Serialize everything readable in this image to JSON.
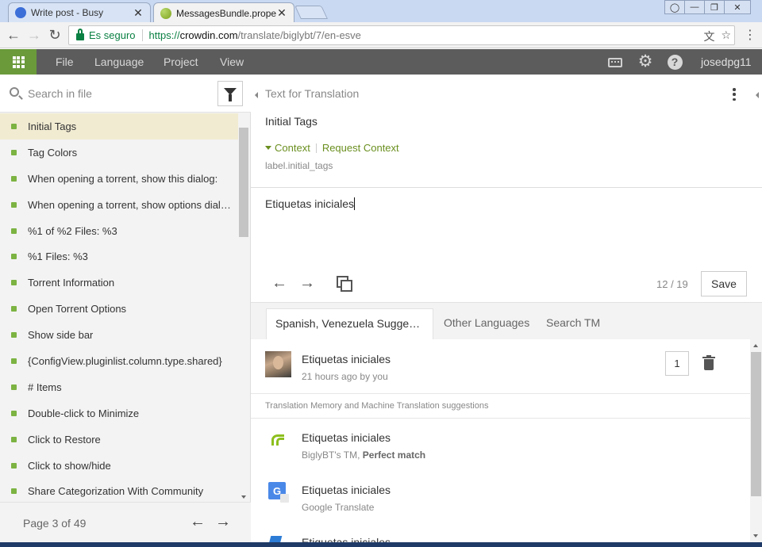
{
  "browser": {
    "tabs": [
      {
        "label": "Write post - Busy",
        "active": false,
        "icon": "busy-icon"
      },
      {
        "label": "MessagesBundle.properti",
        "active": true,
        "icon": "crowdin-icon"
      }
    ],
    "tab_close": "✕",
    "secure_label": "Es seguro",
    "url_proto": "https://",
    "url_host": "crowdin.com",
    "url_path": "/translate/biglybt/7/en-esve",
    "colors": {
      "secure": "#0b8043",
      "tabbar": "#c9d9f2"
    }
  },
  "app": {
    "menu": [
      "File",
      "Language",
      "Project",
      "View"
    ],
    "username": "josedpg11",
    "accent": "#6a9a3a",
    "appbar_bg": "#5c5c5c",
    "icons": [
      "keyboard-icon",
      "gear-icon",
      "help-icon"
    ]
  },
  "left": {
    "search_placeholder": "Search in file",
    "strings": [
      "Initial Tags",
      "Tag Colors",
      "When opening a torrent, show this dialog:",
      "When opening a torrent, show options dialog",
      "%1 of %2 Files: %3",
      "%1 Files: %3",
      "Torrent Information",
      "Open Torrent Options",
      "Show side bar",
      "{ConfigView.pluginlist.column.type.shared}",
      "# Items",
      "Double-click to Minimize",
      "Click to Restore",
      "Click to show/hide",
      "Share Categorization With Community"
    ],
    "selected_index": 0,
    "page_label": "Page 3 of 49"
  },
  "editor": {
    "heading": "Text for Translation",
    "source_text": "Initial Tags",
    "context_label": "Context",
    "request_context_label": "Request Context",
    "context_key": "label.initial_tags",
    "translation": "Etiquetas iniciales",
    "counter": "12 / 19",
    "save_label": "Save"
  },
  "tm": {
    "tabs": [
      "Spanish, Venezuela Suggestions",
      "Other Languages",
      "Search TM"
    ],
    "active_tab": 0,
    "user_suggestion": {
      "text": "Etiquetas iniciales",
      "meta": "21 hours ago by you",
      "votes": "1"
    },
    "section_heading": "Translation Memory and Machine Translation suggestions",
    "machine": [
      {
        "text": "Etiquetas iniciales",
        "source": "BiglyBT's TM,",
        "quality": "Perfect match",
        "icon": "crowdin-logo-icon"
      },
      {
        "text": "Etiquetas iniciales",
        "source": "Google Translate",
        "quality": "",
        "icon": "google-translate-icon"
      },
      {
        "text": "Etiquetas iniciales",
        "source": "",
        "quality": "",
        "icon": "microsoft-translator-icon"
      }
    ]
  }
}
